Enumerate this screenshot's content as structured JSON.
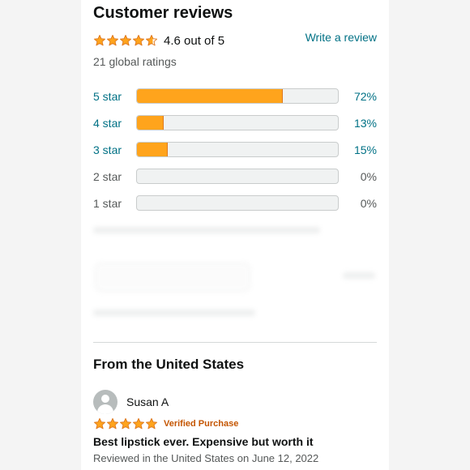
{
  "header": {
    "title": "Customer reviews"
  },
  "summary": {
    "stars": 4.6,
    "rating_text": "4.6 out of 5",
    "write_review_label": "Write a review",
    "global_ratings": "21 global ratings"
  },
  "histogram": [
    {
      "label": "5 star",
      "percent_text": "72%",
      "percent": 72,
      "active": true
    },
    {
      "label": "4 star",
      "percent_text": "13%",
      "percent": 13,
      "active": true
    },
    {
      "label": "3 star",
      "percent_text": "15%",
      "percent": 15,
      "active": true
    },
    {
      "label": "2 star",
      "percent_text": "0%",
      "percent": 0,
      "active": false
    },
    {
      "label": "1 star",
      "percent_text": "0%",
      "percent": 0,
      "active": false
    }
  ],
  "section": {
    "title": "From the United States"
  },
  "review": {
    "reviewer": "Susan A",
    "stars": 5,
    "badge": "Verified Purchase",
    "title": "Best lipstick ever. Expensive but worth it",
    "date": "Reviewed in the United States on June 12, 2022"
  },
  "colors": {
    "star": "#ffa41c",
    "link": "#007185",
    "bar_fill": "#ffa41c",
    "badge": "#c45500"
  },
  "icons": {
    "star": "star-icon",
    "avatar": "user-avatar-icon"
  }
}
